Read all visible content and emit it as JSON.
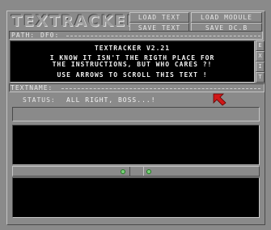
{
  "app": {
    "logo": "TEXTRACKER"
  },
  "toolbar": {
    "load_text": "LOAD TEXT",
    "load_module": "LOAD MODULE",
    "save_text": "SAVE TEXT",
    "save_dcb": "SAVE DC.B"
  },
  "path": {
    "label": "PATH:",
    "value": "DF0:"
  },
  "text_display": {
    "lines": [
      "TEXTRACKER V2.21",
      "I KNOW IT ISN'T THE RIGTH PLACE FOR",
      "THE INSTRUCTIONS, BUT WHO CARES ?!",
      "",
      "USE ARROWS TO SCROLL THIS TEXT !"
    ]
  },
  "scroll_buttons": [
    "E",
    "X",
    "I",
    "T"
  ],
  "textname": {
    "label": "TEXTNAME:",
    "value": ""
  },
  "status": {
    "label": "STATUS:",
    "value": "ALL RIGHT, BOSS...!"
  },
  "colors": {
    "panel": "#8a8a8a",
    "screen": "#000000",
    "accent": "#d01818",
    "indicator": "#7ad07a"
  },
  "icons": {
    "pointer": "red-arrow-cursor-icon",
    "indicator": "green-dot-icon"
  }
}
